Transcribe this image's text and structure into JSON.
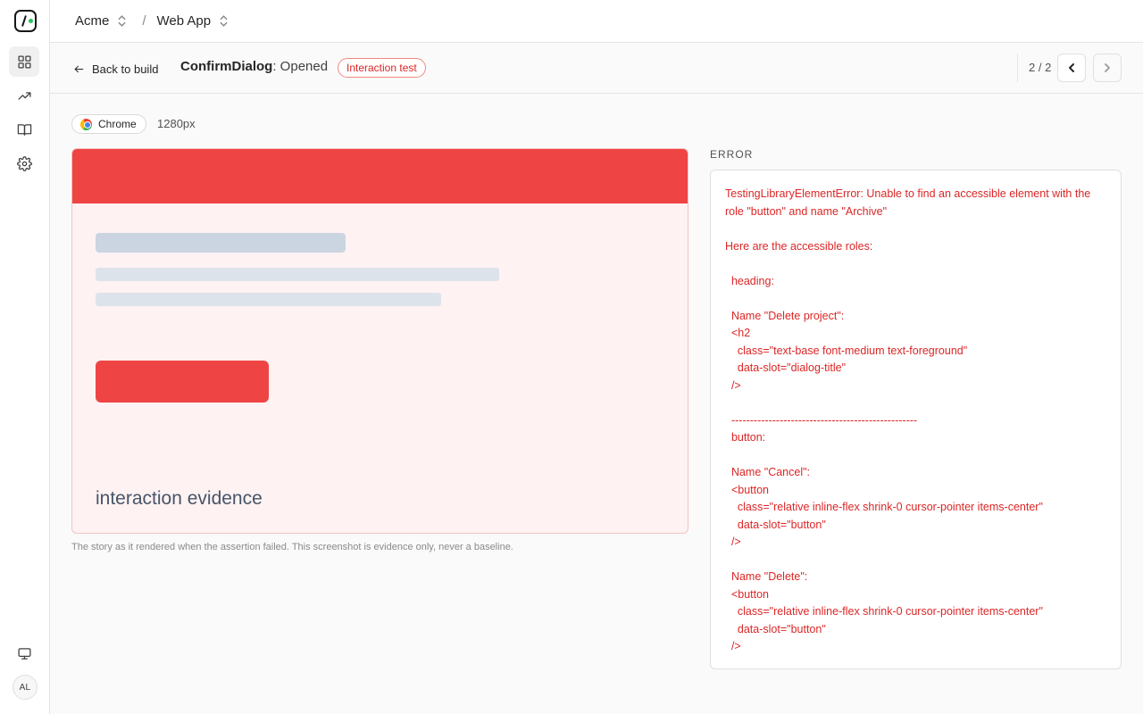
{
  "sidebar": {
    "items": [
      {
        "icon": "grid-icon",
        "label": "Builds"
      },
      {
        "icon": "trend-icon",
        "label": "Activity"
      },
      {
        "icon": "book-icon",
        "label": "Docs"
      },
      {
        "icon": "gear-icon",
        "label": "Settings"
      }
    ],
    "bottom_icon": "monitor-icon",
    "avatar_initials": "AL"
  },
  "topbar": {
    "org": "Acme",
    "separator": "/",
    "project": "Web App"
  },
  "subheader": {
    "back_label": "Back to build",
    "component_name": "ConfirmDialog",
    "story_state": ": Opened",
    "badge": "Interaction test",
    "pager": "2 / 2"
  },
  "environment": {
    "browser": "Chrome",
    "viewport": "1280px"
  },
  "evidence": {
    "caption": "interaction evidence",
    "note": "The story as it rendered when the assertion failed. This screenshot is evidence only, never a baseline."
  },
  "error": {
    "heading": "ERROR",
    "message": "TestingLibraryElementError: Unable to find an accessible element with the role \"button\" and name \"Archive\"\n\nHere are the accessible roles:\n\n  heading:\n\n  Name \"Delete project\":\n  <h2\n    class=\"text-base font-medium text-foreground\"\n    data-slot=\"dialog-title\"\n  />\n\n  --------------------------------------------------\n  button:\n\n  Name \"Cancel\":\n  <button\n    class=\"relative inline-flex shrink-0 cursor-pointer items-center\"\n    data-slot=\"button\"\n  />\n\n  Name \"Delete\":\n  <button\n    class=\"relative inline-flex shrink-0 cursor-pointer items-center\"\n    data-slot=\"button\"\n  />"
  },
  "colors": {
    "accent_red": "#ef4444",
    "error_text": "#dc2626",
    "logo_dot": "#22c55e"
  }
}
